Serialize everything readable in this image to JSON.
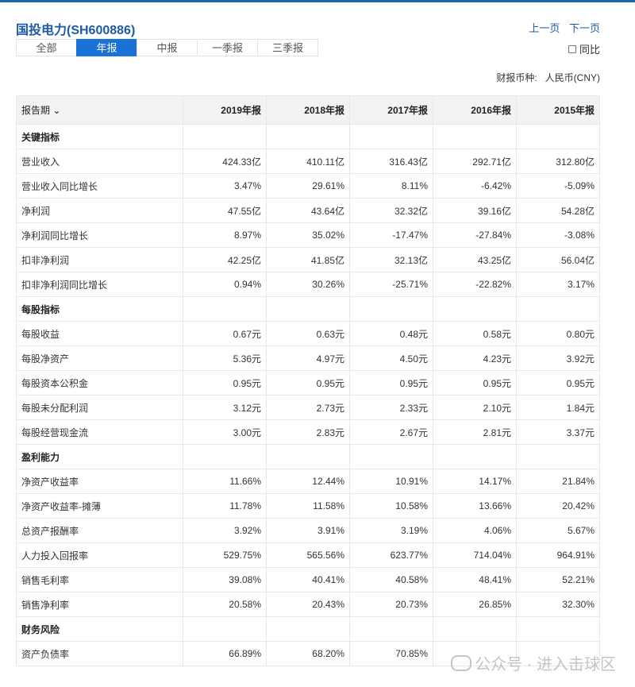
{
  "header": {
    "title": "国投电力(SH600886)",
    "prev_page": "上一页",
    "next_page": "下一页"
  },
  "tabs": [
    {
      "label": "全部",
      "active": false
    },
    {
      "label": "年报",
      "active": true
    },
    {
      "label": "中报",
      "active": false
    },
    {
      "label": "一季报",
      "active": false
    },
    {
      "label": "三季报",
      "active": false
    }
  ],
  "yoy_label": "同比",
  "currency": {
    "label": "财报币种:",
    "value": "人民币(CNY)"
  },
  "table": {
    "first_header": "报告期",
    "columns": [
      "2019年报",
      "2018年报",
      "2017年报",
      "2016年报",
      "2015年报"
    ],
    "rows": [
      {
        "section": true,
        "name": "关键指标",
        "values": [
          "",
          "",
          "",
          "",
          ""
        ]
      },
      {
        "name": "营业收入",
        "values": [
          "424.33亿",
          "410.11亿",
          "316.43亿",
          "292.71亿",
          "312.80亿"
        ]
      },
      {
        "name": "营业收入同比增长",
        "values": [
          "3.47%",
          "29.61%",
          "8.11%",
          "-6.42%",
          "-5.09%"
        ]
      },
      {
        "name": "净利润",
        "values": [
          "47.55亿",
          "43.64亿",
          "32.32亿",
          "39.16亿",
          "54.28亿"
        ]
      },
      {
        "name": "净利润同比增长",
        "values": [
          "8.97%",
          "35.02%",
          "-17.47%",
          "-27.84%",
          "-3.08%"
        ]
      },
      {
        "name": "扣非净利润",
        "values": [
          "42.25亿",
          "41.85亿",
          "32.13亿",
          "43.25亿",
          "56.04亿"
        ]
      },
      {
        "name": "扣非净利润同比增长",
        "values": [
          "0.94%",
          "30.26%",
          "-25.71%",
          "-22.82%",
          "3.17%"
        ]
      },
      {
        "section": true,
        "name": "每股指标",
        "values": [
          "",
          "",
          "",
          "",
          ""
        ]
      },
      {
        "name": "每股收益",
        "values": [
          "0.67元",
          "0.63元",
          "0.48元",
          "0.58元",
          "0.80元"
        ]
      },
      {
        "name": "每股净资产",
        "values": [
          "5.36元",
          "4.97元",
          "4.50元",
          "4.23元",
          "3.92元"
        ]
      },
      {
        "name": "每股资本公积金",
        "values": [
          "0.95元",
          "0.95元",
          "0.95元",
          "0.95元",
          "0.95元"
        ]
      },
      {
        "name": "每股未分配利润",
        "values": [
          "3.12元",
          "2.73元",
          "2.33元",
          "2.10元",
          "1.84元"
        ]
      },
      {
        "name": "每股经营现金流",
        "values": [
          "3.00元",
          "2.83元",
          "2.67元",
          "2.81元",
          "3.37元"
        ]
      },
      {
        "section": true,
        "name": "盈利能力",
        "values": [
          "",
          "",
          "",
          "",
          ""
        ]
      },
      {
        "name": "净资产收益率",
        "values": [
          "11.66%",
          "12.44%",
          "10.91%",
          "14.17%",
          "21.84%"
        ]
      },
      {
        "name": "净资产收益率-摊薄",
        "values": [
          "11.78%",
          "11.58%",
          "10.58%",
          "13.66%",
          "20.42%"
        ]
      },
      {
        "name": "总资产报酬率",
        "values": [
          "3.92%",
          "3.91%",
          "3.19%",
          "4.06%",
          "5.67%"
        ]
      },
      {
        "name": "人力投入回报率",
        "values": [
          "529.75%",
          "565.56%",
          "623.77%",
          "714.04%",
          "964.91%"
        ]
      },
      {
        "name": "销售毛利率",
        "values": [
          "39.08%",
          "40.41%",
          "40.58%",
          "48.41%",
          "52.21%"
        ]
      },
      {
        "name": "销售净利率",
        "values": [
          "20.58%",
          "20.43%",
          "20.73%",
          "26.85%",
          "32.30%"
        ]
      },
      {
        "section": true,
        "name": "财务风险",
        "values": [
          "",
          "",
          "",
          "",
          ""
        ]
      },
      {
        "name": "资产负债率",
        "values": [
          "66.89%",
          "68.20%",
          "70.85%",
          "",
          ""
        ]
      }
    ]
  },
  "watermark": "公众号 · 进入击球区"
}
